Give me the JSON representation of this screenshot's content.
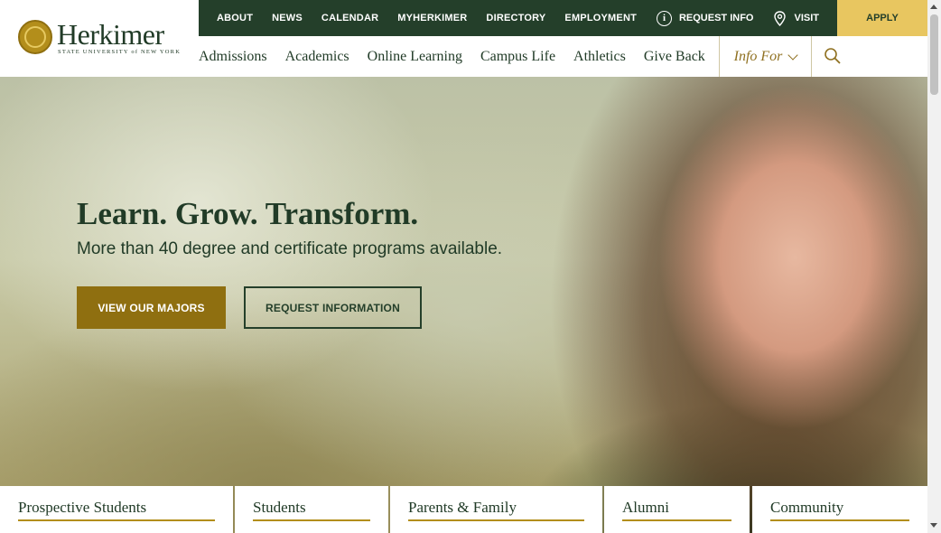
{
  "logo": {
    "name": "Herkimer",
    "tagline": "STATE UNIVERSITY of NEW YORK",
    "icon": "college-seal-icon"
  },
  "utility_nav": {
    "links": [
      "ABOUT",
      "NEWS",
      "CALENDAR",
      "MYHERKIMER",
      "DIRECTORY",
      "EMPLOYMENT"
    ],
    "request_info": "REQUEST INFO",
    "visit": "VISIT",
    "apply": "APPLY"
  },
  "main_nav": {
    "items": [
      "Admissions",
      "Academics",
      "Online Learning",
      "Campus Life",
      "Athletics",
      "Give Back"
    ],
    "info_for": "Info For",
    "search_icon": "search-icon"
  },
  "hero": {
    "headline": "Learn. Grow. Transform.",
    "subheadline": "More than 40 degree and certificate programs available.",
    "primary_button": "VIEW OUR MAJORS",
    "secondary_button": "REQUEST INFORMATION"
  },
  "audience_tabs": [
    "Prospective Students",
    "Students",
    "Parents & Family",
    "Alumni",
    "Community"
  ],
  "colors": {
    "primary_green": "#243f2a",
    "gold": "#8f6f10",
    "apply_gold": "#e8c660",
    "accent_line": "#b38e1b"
  }
}
